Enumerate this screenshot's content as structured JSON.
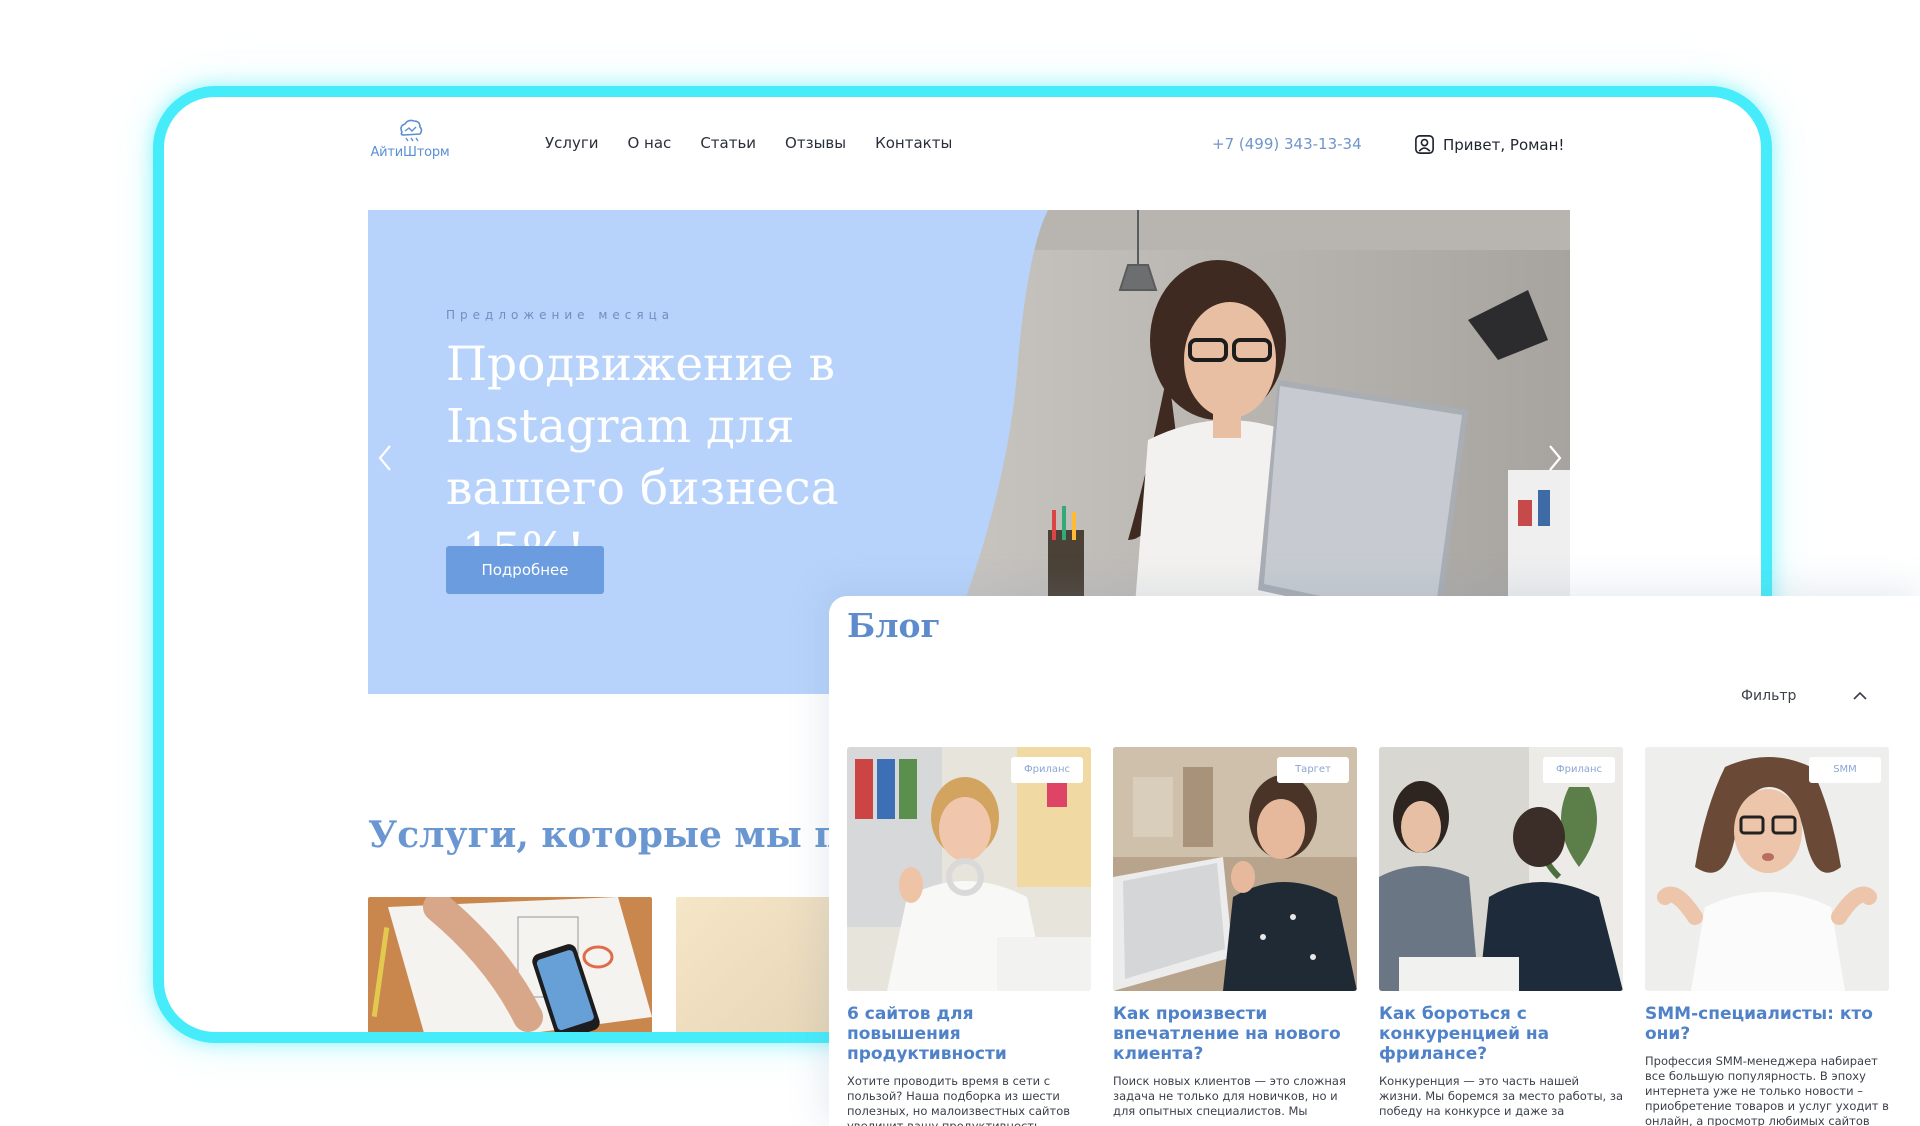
{
  "header": {
    "logo_text": "АйтиШторм",
    "nav": [
      "Услуги",
      "О нас",
      "Статьи",
      "Отзывы",
      "Контакты"
    ],
    "phone": "+7 (499) 343-13-34",
    "greeting": "Привет, Роман!"
  },
  "hero": {
    "eyebrow": "Предложение месяца",
    "title": "Продвижение в Instagram для вашего бизнеса -15%!",
    "button": "Подробнее",
    "prev_icon": "chevron-left-icon",
    "next_icon": "chevron-right-icon"
  },
  "services": {
    "title": "Услуги, которые мы предл"
  },
  "blog": {
    "title": "Блог",
    "filter_label": "Фильтр",
    "cards": [
      {
        "tag": "Фриланс",
        "title": "6 сайтов для повышения продуктивности",
        "text": "Хотите проводить время в сети с пользой? Наша подборка из шести полезных, но малоизвестных сайтов увеличит вашу продуктивность, поможет успевать больше в течение"
      },
      {
        "tag": "Таргет",
        "title": "Как произвести впечатление на нового клиента?",
        "text": "Поиск новых клиентов — это сложная задача не только для новичков, но и для опытных специалистов. Мы"
      },
      {
        "tag": "Фриланс",
        "title": "Как бороться с конкуренцией на фрилансе?",
        "text": "Конкуренция — это часть нашей жизни. Мы боремся за место работы, за победу на конкурсе и даже за"
      },
      {
        "tag": "SMM",
        "title": "SMM-специалисты: кто они?",
        "text": "Профессия SMM-менеджера набирает все большую популярность. В эпоху интернета уже не только новости – приобретение товаров и услуг уходит в онлайн, а просмотр любимых сайтов"
      }
    ]
  },
  "colors": {
    "frame": "#46ecfa",
    "accent": "#6b9ce0",
    "hero_bg": "#b7d3fb",
    "link": "#4f82c9"
  }
}
